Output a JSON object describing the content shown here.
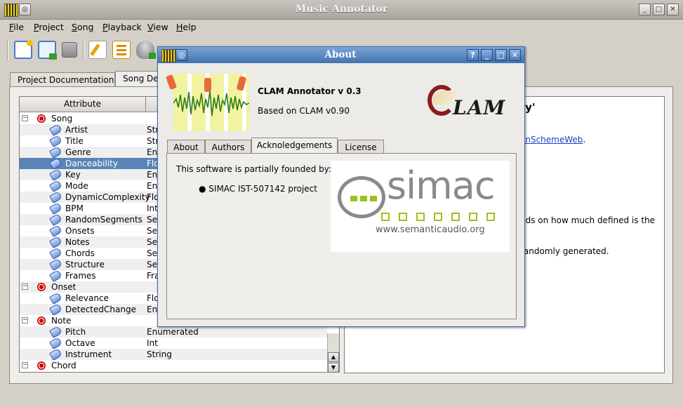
{
  "window": {
    "title": "Music Annotator"
  },
  "menu": [
    "File",
    "Project",
    "Song",
    "Playback",
    "View",
    "Help"
  ],
  "toolbar": {
    "icons": [
      "new-project-icon",
      "open-project-icon",
      "save-project-icon",
      "edit-icon",
      "schema-icon",
      "database-icon",
      "disk-icon",
      "play-icon",
      "pause-icon",
      "stop-icon",
      "next-icon",
      "flag-icon"
    ]
  },
  "tabs": {
    "project_documentation": "Project Documentation",
    "song_descriptors": "Song De"
  },
  "tree": {
    "header_attribute": "Attribute",
    "rows": [
      {
        "type": "group",
        "label": "Song"
      },
      {
        "type": "attr",
        "name": "Artist",
        "kind": "Str"
      },
      {
        "type": "attr",
        "name": "Title",
        "kind": "Str"
      },
      {
        "type": "attr",
        "name": "Genre",
        "kind": "En"
      },
      {
        "type": "attr",
        "name": "Danceability",
        "kind": "Flo",
        "selected": true
      },
      {
        "type": "attr",
        "name": "Key",
        "kind": "En"
      },
      {
        "type": "attr",
        "name": "Mode",
        "kind": "En"
      },
      {
        "type": "attr",
        "name": "DynamicComplexity",
        "kind": "Flo"
      },
      {
        "type": "attr",
        "name": "BPM",
        "kind": "Int"
      },
      {
        "type": "attr",
        "name": "RandomSegments",
        "kind": "Se"
      },
      {
        "type": "attr",
        "name": "Onsets",
        "kind": "Se"
      },
      {
        "type": "attr",
        "name": "Notes",
        "kind": "Se"
      },
      {
        "type": "attr",
        "name": "Chords",
        "kind": "Se"
      },
      {
        "type": "attr",
        "name": "Structure",
        "kind": "Se"
      },
      {
        "type": "attr",
        "name": "Frames",
        "kind": "Fra"
      },
      {
        "type": "group",
        "label": "Onset"
      },
      {
        "type": "attr",
        "name": "Relevance",
        "kind": "Flo"
      },
      {
        "type": "attr",
        "name": "DetectedChange",
        "kind": "En"
      },
      {
        "type": "group",
        "label": "Note"
      },
      {
        "type": "attr",
        "name": "Pitch",
        "kind": "Enumerated"
      },
      {
        "type": "attr",
        "name": "Octave",
        "kind": "Int"
      },
      {
        "type": "attr",
        "name": "Instrument",
        "kind": "String"
      },
      {
        "type": "group",
        "label": "Chord"
      }
    ]
  },
  "doc": {
    "heading": "ty'",
    "link": "onSchemeWeb",
    "period": ".",
    "text1": "nds on how much defined is the",
    "text2": "randomly generated."
  },
  "dialog": {
    "title": "About",
    "app_name": "CLAM Annotator v 0.3",
    "based_on": "Based on CLAM v0.90",
    "clam_logo": "LAM",
    "tabs": [
      "About",
      "Authors",
      "Acknoledgements",
      "License"
    ],
    "active_tab": "Acknoledgements",
    "founded_text": "This software is partially founded by:",
    "project": "SIMAC IST-507142 project",
    "simac_logo": "simac",
    "simac_url": "www.semanticaudio.org",
    "colors": {
      "simac_green": "#9bc31c",
      "simac_grey": "#8a8a8a"
    }
  }
}
